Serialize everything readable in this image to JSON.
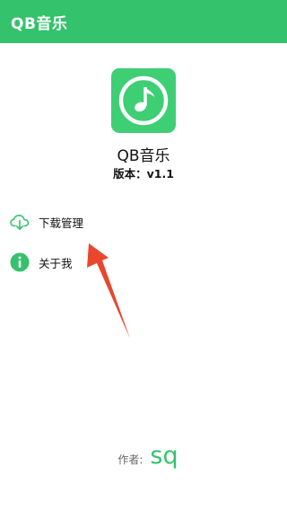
{
  "app_bar": {
    "title": "QB音乐",
    "color": "#34c26c"
  },
  "about": {
    "logo_icon": "music-note-icon",
    "app_name": "QB音乐",
    "version_label": "版本：",
    "version_value": "v1.1"
  },
  "menu": {
    "items": [
      {
        "icon": "cloud-download-icon",
        "label": "下载管理"
      },
      {
        "icon": "info-icon",
        "label": "关于我"
      }
    ]
  },
  "annotation": {
    "arrow_color": "#e8472e",
    "arrow_icon": "red-arrow-icon"
  },
  "author": {
    "label": "作者:",
    "name": "sq"
  }
}
